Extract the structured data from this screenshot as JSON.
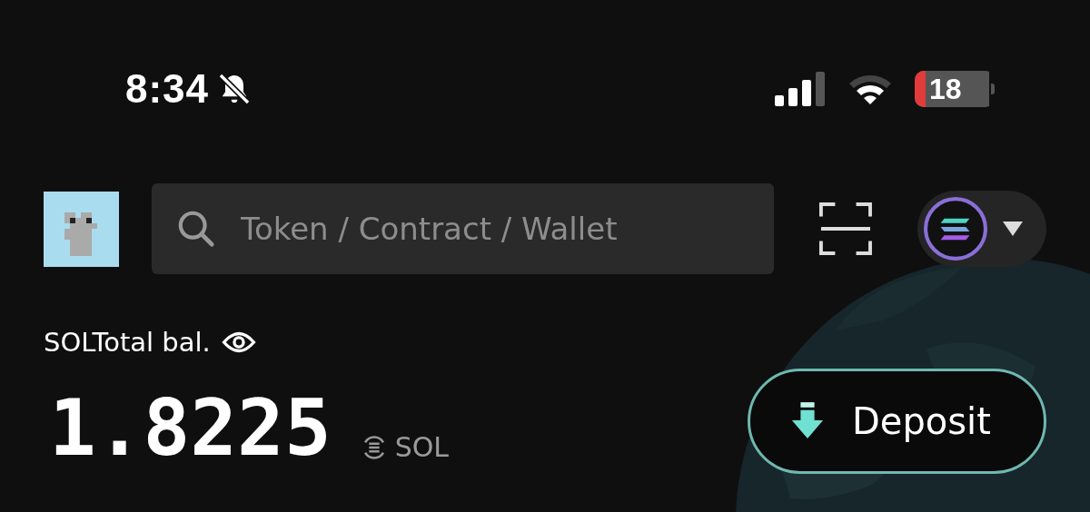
{
  "status_bar": {
    "time": "8:34",
    "battery": "18"
  },
  "header": {
    "search": {
      "placeholder": "Token / Contract / Wallet"
    }
  },
  "balance": {
    "label": "SOLTotal bal.",
    "amount": "1.8225",
    "unit": "SOL"
  },
  "buttons": [
    {
      "label": "Deposit"
    }
  ]
}
